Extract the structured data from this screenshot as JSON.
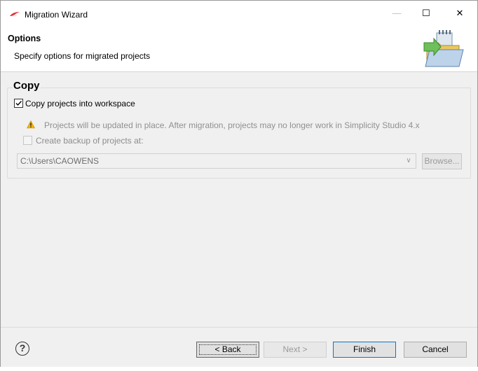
{
  "window": {
    "title": "Migration Wizard",
    "controls": {
      "minimize": "—",
      "maximize": "☐",
      "close": "✕"
    }
  },
  "header": {
    "title": "Options",
    "subtitle": "Specify options for migrated projects",
    "image_icon": "folder-import-icon"
  },
  "copy_group": {
    "title": "Copy",
    "copy_into_workspace": {
      "label": "Copy projects into workspace",
      "checked": true
    },
    "warning": "Projects will be updated in place.  After migration, projects may no longer work in Simplicity Studio 4.x",
    "create_backup": {
      "label": "Create backup of projects at:",
      "checked": false,
      "enabled": false
    },
    "backup_path": "C:\\Users\\CAOWENS",
    "browse_label": "Browse..."
  },
  "footer": {
    "help_label": "?",
    "back_label": "< Back",
    "next_label": "Next >",
    "finish_label": "Finish",
    "cancel_label": "Cancel"
  },
  "colors": {
    "accent": "#0078d7",
    "warning": "#f2b400",
    "app_icon": "#d9383a"
  }
}
